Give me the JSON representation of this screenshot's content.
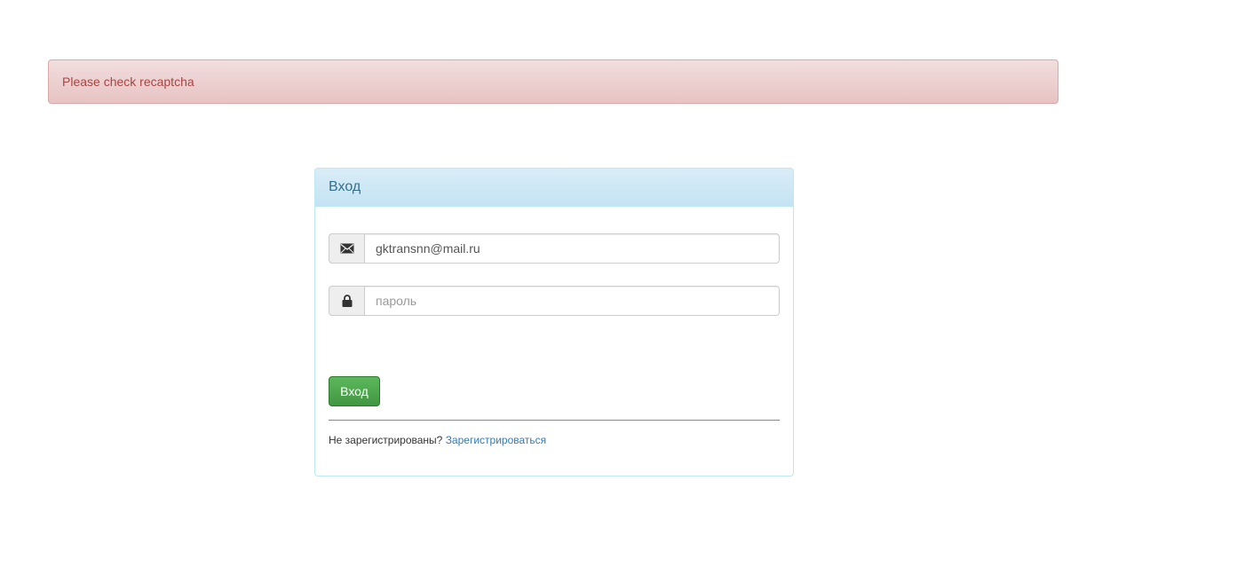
{
  "alert": {
    "message": "Please check recaptcha"
  },
  "login_panel": {
    "title": "Вход",
    "email_field": {
      "icon": "envelope-icon",
      "value": "gktransnn@mail.ru",
      "placeholder": ""
    },
    "password_field": {
      "icon": "lock-icon",
      "value": "",
      "placeholder": "пароль"
    },
    "submit_label": "Вход",
    "register_prompt": "Не зарегистрированы?",
    "register_link": "Зарегистрироваться"
  },
  "colors": {
    "alert_text": "#a94442",
    "alert_bg": "#f2dede",
    "panel_heading_text": "#31708f",
    "panel_border": "#bce8f1",
    "button_bg": "#5cb85c",
    "link": "#337ab7"
  }
}
